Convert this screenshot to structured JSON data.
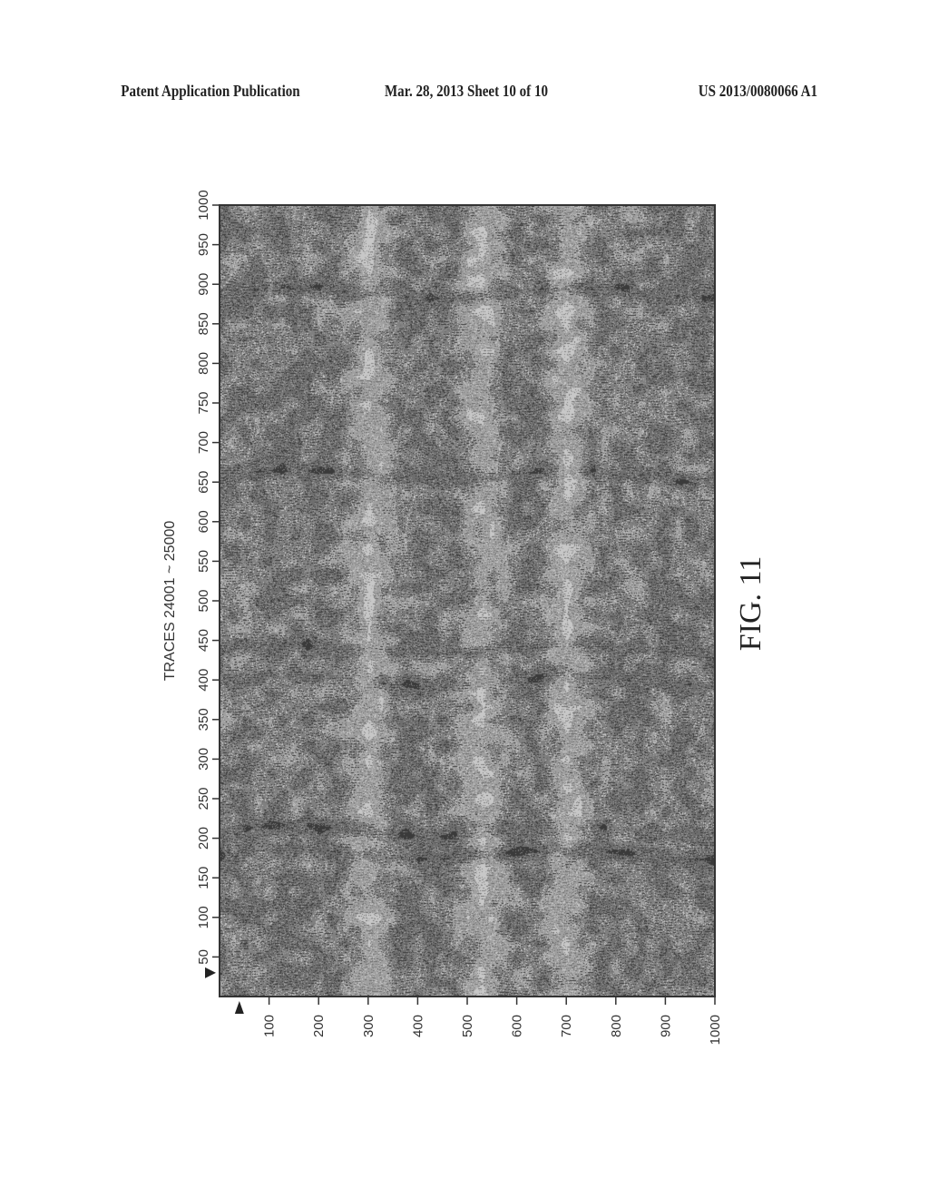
{
  "header": {
    "publication": "Patent Application Publication",
    "date_sheet": "Mar. 28, 2013  Sheet 10 of 10",
    "pub_number": "US 2013/0080066 A1"
  },
  "figure": {
    "label": "FIG. 11"
  },
  "chart_data": {
    "type": "heatmap",
    "title": "",
    "colormap": "grayscale",
    "description": "Seismic section image, grayscale amplitude display",
    "ylabel": "TRACES 24001 ~ 25000",
    "xlabel": "",
    "y_axis": {
      "label": "TRACES 24001 ~ 25000",
      "range": [
        0,
        1000
      ],
      "ticks": [
        50,
        100,
        150,
        200,
        250,
        300,
        350,
        400,
        450,
        500,
        550,
        600,
        650,
        700,
        750,
        800,
        850,
        900,
        950,
        1000
      ],
      "tick_labels": [
        "50",
        "100",
        "150",
        "200",
        "250",
        "300",
        "350",
        "400",
        "450",
        "500",
        "550",
        "600",
        "650",
        "700",
        "750",
        "800",
        "850",
        "900",
        "950",
        "1000"
      ]
    },
    "x_axis": {
      "range": [
        0,
        1000
      ],
      "ticks": [
        100,
        200,
        300,
        400,
        500,
        600,
        700,
        800,
        900,
        1000
      ],
      "tick_labels": [
        "100",
        "200",
        "300",
        "400",
        "500",
        "600",
        "700",
        "800",
        "900",
        "1000"
      ]
    },
    "markers": [
      {
        "axis": "y",
        "value": 30,
        "shape": "triangle"
      },
      {
        "axis": "x",
        "value": 40,
        "shape": "triangle"
      }
    ],
    "features": {
      "light_bands_x": [
        300,
        500,
        700
      ],
      "dark_reflectors_y": [
        180,
        210,
        400,
        440,
        660,
        890
      ],
      "colors": {
        "dark": "#3a3a3a",
        "mid": "#7a7a7a",
        "light": "#c8c8c8",
        "frame": "#333333"
      }
    },
    "grid": false,
    "legend": "none"
  }
}
